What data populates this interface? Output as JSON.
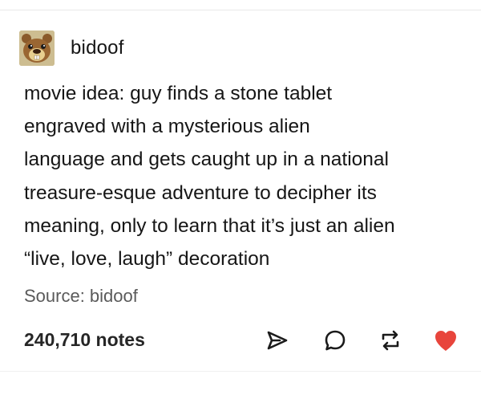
{
  "post": {
    "username": "bidoof",
    "avatar_icon": "bidoof-avatar-icon",
    "body_lines": [
      "movie idea: guy finds a stone tablet",
      "engraved with a mysterious alien",
      "language and gets caught up in a national",
      "treasure-esque adventure to decipher its",
      "meaning, only to learn that it’s just an alien",
      "“live, love, laugh” decoration"
    ],
    "source": "Source: bidoof",
    "notes": "240,710 notes"
  },
  "actions": {
    "share_icon": "share-icon",
    "reply_icon": "reply-icon",
    "reblog_icon": "reblog-icon",
    "like_icon": "heart-icon",
    "like_color": "#e8453c"
  }
}
